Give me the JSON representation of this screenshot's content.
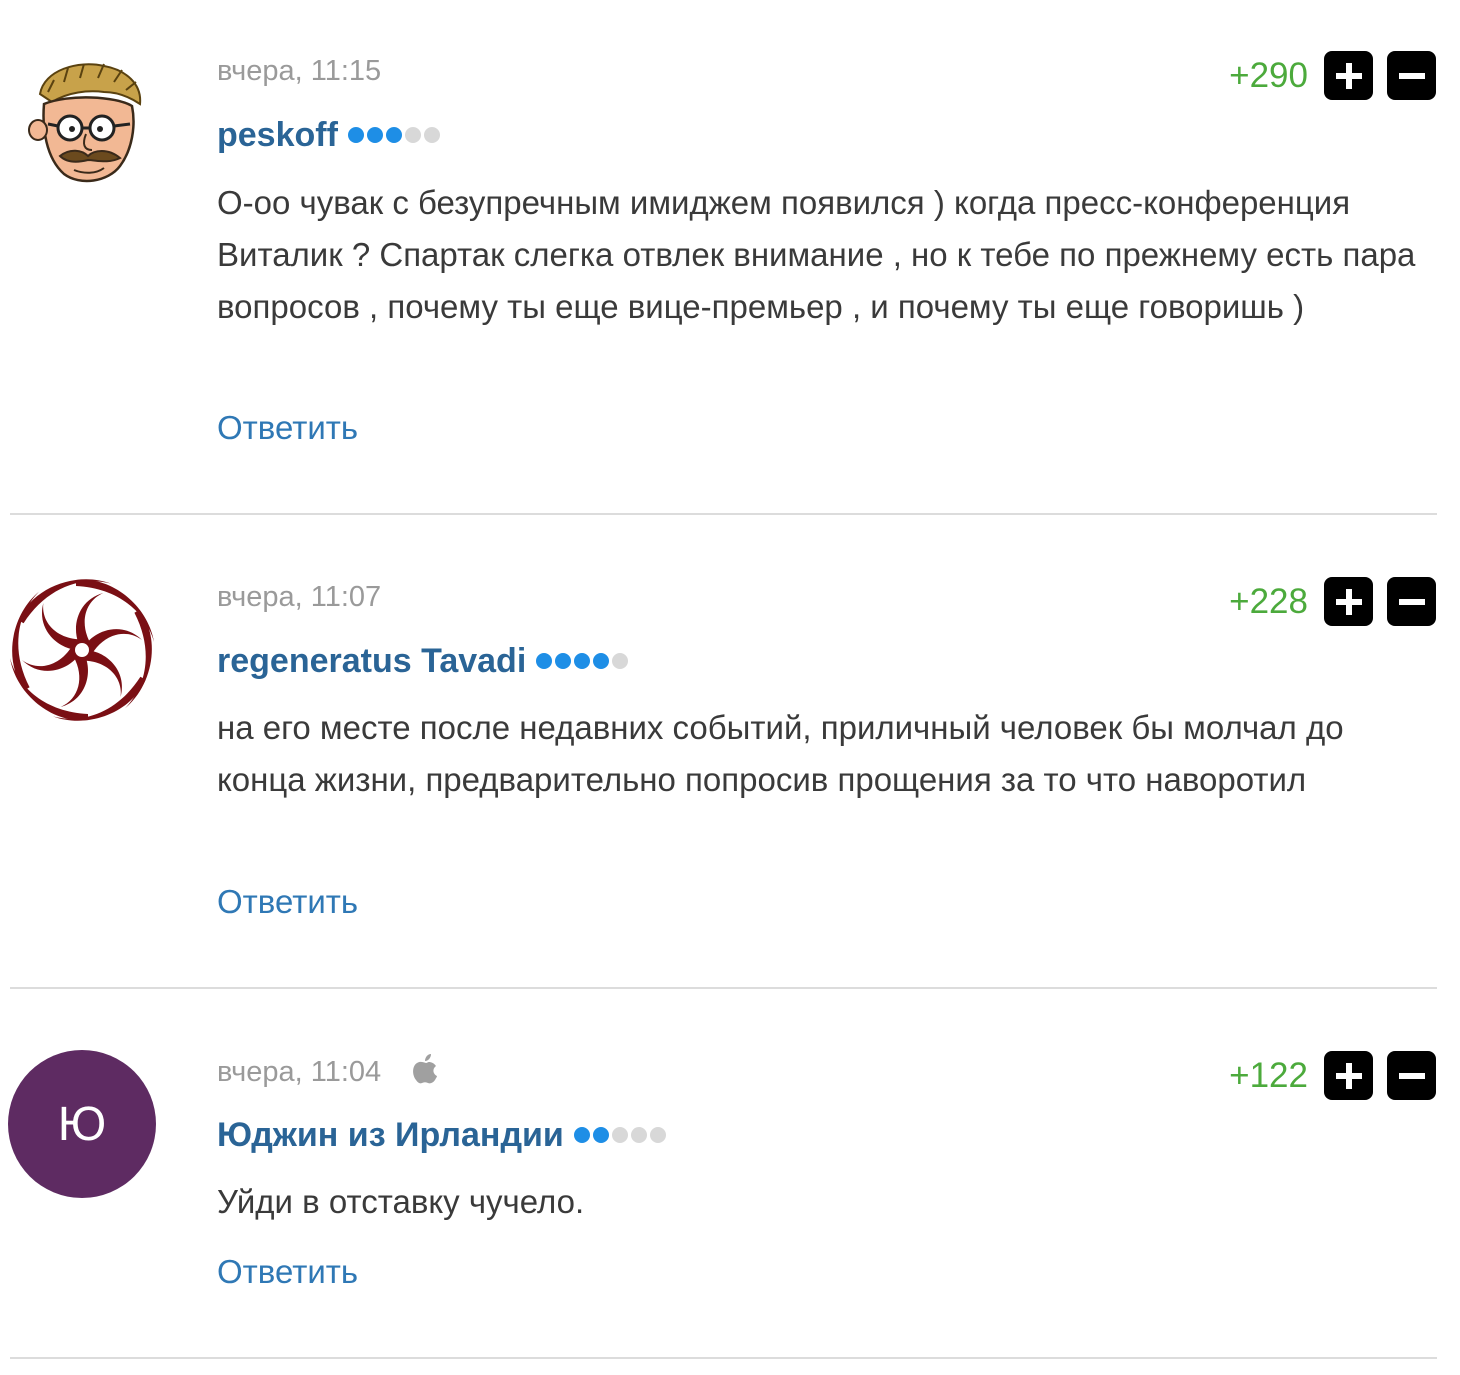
{
  "comments": [
    {
      "time": "вчера, 11:15",
      "author": "peskoff",
      "rating": {
        "filled": 3,
        "total": 5
      },
      "text": "О-оо чувак с безупречным имиджем появился ) когда пресс-конференция Виталик ? Спартак слегка отвлек внимание , но к тебе по прежнему есть пара вопросов , почему ты еще вице-премьер , и почему ты еще говоришь )",
      "score": "+290",
      "reply_label": "Ответить",
      "avatar": {
        "type": "cartoon-face-icon"
      }
    },
    {
      "time": "вчера, 11:07",
      "author": "regeneratus Tavadi",
      "rating": {
        "filled": 4,
        "total": 5
      },
      "text": "на его месте после недавних событий, приличный человек бы молчал до конца жизни, предварительно попросив прощения за то что наворотил",
      "score": "+228",
      "reply_label": "Ответить",
      "avatar": {
        "type": "swirl-icon",
        "color": "#7a0f14"
      }
    },
    {
      "time": "вчера, 11:04",
      "author": "Юджин из Ирландии",
      "rating": {
        "filled": 2,
        "total": 5
      },
      "text": "Уйди в отставку чучело.",
      "score": "+122",
      "reply_label": "Ответить",
      "avatar": {
        "type": "letter",
        "letter": "Ю",
        "color": "#5e2b62"
      },
      "device_icon": "apple-icon"
    }
  ],
  "colors": {
    "author": "#2a6496",
    "reply": "#2f78b5",
    "score": "#4caa3c",
    "rating_on": "#1e8ee6",
    "rating_off": "#d8d8d8"
  }
}
